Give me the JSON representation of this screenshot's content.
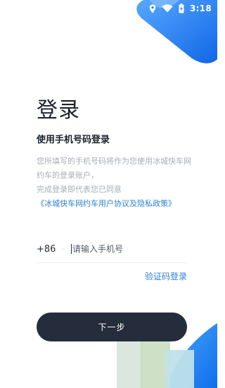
{
  "status_bar": {
    "time": "3:18",
    "icons": [
      "location-icon",
      "wifi-icon",
      "battery-charging-icon"
    ]
  },
  "page": {
    "title": "登录",
    "subtitle": "使用手机号码登录",
    "notice_line1": "您所填写的手机号码将作为您使用冰城快车网约车的登录账户，",
    "notice_line2": "完成登录即代表您已同意",
    "policy_link": "《冰城快车网约车用户协议及隐私政策》"
  },
  "form": {
    "country_code": "+86",
    "separator": "·",
    "phone_placeholder": "请输入手机号",
    "code_login_label": "验证码登录",
    "next_button_label": "下一步"
  },
  "colors": {
    "accent_blue": "#2f7fd4",
    "button_dark": "#252c3b",
    "deco_blue": "#1e7bf0"
  }
}
